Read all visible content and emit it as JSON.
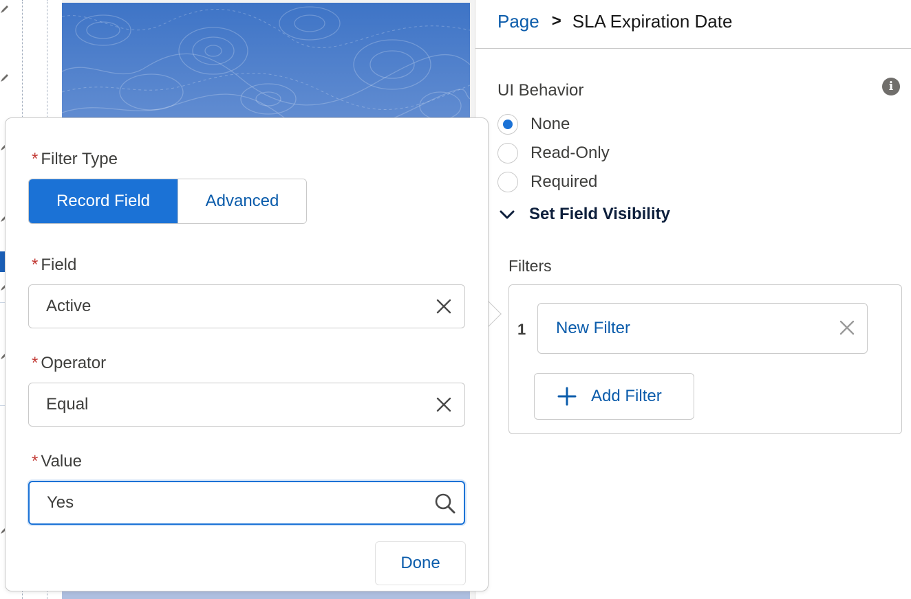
{
  "breadcrumb": {
    "parent": "Page",
    "separator": ">",
    "current": "SLA Expiration Date"
  },
  "ui_behavior": {
    "label": "UI Behavior",
    "info_icon": "info-icon",
    "options": [
      {
        "label": "None",
        "checked": true
      },
      {
        "label": "Read-Only",
        "checked": false
      },
      {
        "label": "Required",
        "checked": false
      }
    ]
  },
  "visibility": {
    "label": "Set Field Visibility",
    "icon": "chevron-down-icon",
    "expanded": true
  },
  "filters": {
    "label": "Filters",
    "items": [
      {
        "number": "1",
        "label": "New Filter"
      }
    ],
    "add_label": "Add Filter"
  },
  "popover": {
    "required_marker": "*",
    "filter_type": {
      "label": "Filter Type",
      "options": [
        {
          "label": "Record Field",
          "selected": true
        },
        {
          "label": "Advanced",
          "selected": false
        }
      ]
    },
    "field": {
      "label": "Field",
      "value": "Active"
    },
    "operator": {
      "label": "Operator",
      "value": "Equal"
    },
    "value": {
      "label": "Value",
      "value": "Yes"
    },
    "done_label": "Done"
  },
  "colors": {
    "brand": "#1b72d6",
    "link": "#0b5cab",
    "required": "#c23934",
    "border": "#c9c9c9"
  }
}
